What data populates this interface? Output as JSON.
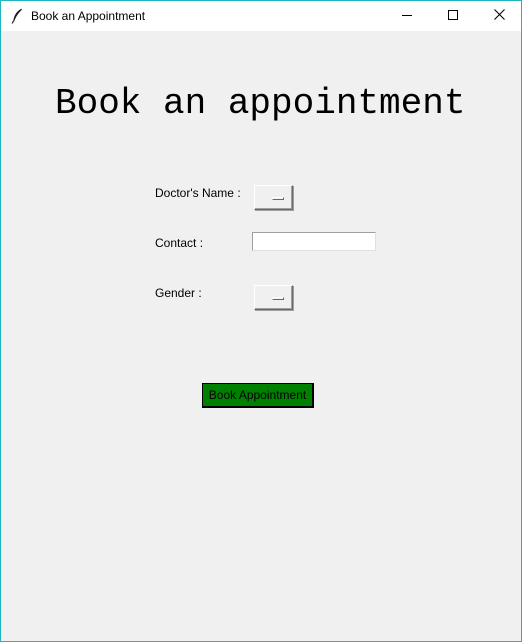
{
  "window": {
    "title": "Book an Appointment",
    "icon": "feather-icon",
    "controls": [
      "minimize-icon",
      "maximize-icon",
      "close-icon"
    ],
    "border_color": "#1fb6c3",
    "background": "#f0f0f0"
  },
  "main": {
    "heading": "Book an appointment",
    "form": {
      "doctor_label": "Doctor's Name :",
      "doctor_value": "",
      "contact_label": "Contact :",
      "contact_value": "",
      "gender_label": "Gender :",
      "gender_value": ""
    },
    "submit_label": "Book Appointment",
    "submit_color": "#008000"
  }
}
